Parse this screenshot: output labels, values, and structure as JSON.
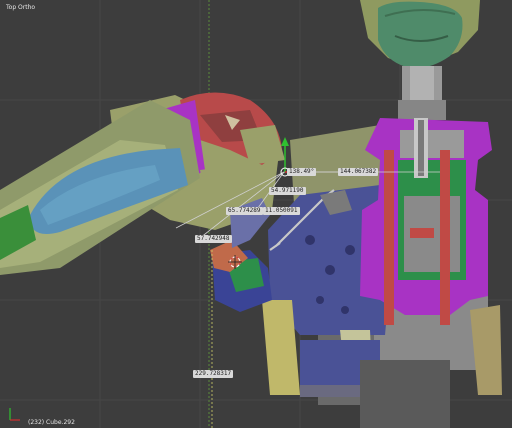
{
  "viewport": {
    "view_label": "Top Ortho",
    "object_label": "(232) Cube.292"
  },
  "measurements": {
    "m1": "138.49°",
    "m2": "144.067382",
    "m3": "54.971190",
    "m4": "65.774289",
    "m5": "11.050091",
    "m6": "57.742948",
    "m7": "229.728317"
  },
  "colors": {
    "background": "#3d3d3d",
    "magenta": "#a833c4",
    "navy": "#4a5296",
    "khaki": "#9aa06a",
    "measure_line": "#d0d0d0"
  },
  "icons": {
    "axis": "axis-gizmo-icon",
    "cursor": "3d-cursor-icon",
    "manipulator": "transform-manipulator-icon"
  }
}
